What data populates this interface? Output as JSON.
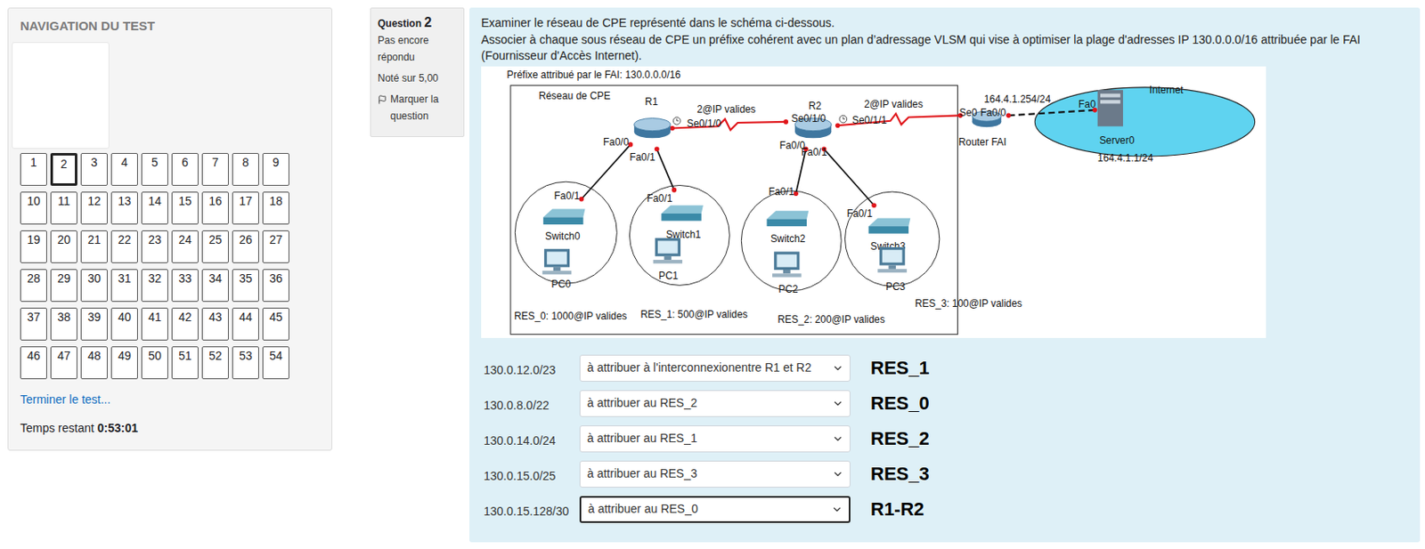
{
  "navigation": {
    "title": "NAVIGATION DU TEST",
    "items": [
      {
        "label": "1",
        "current": false
      },
      {
        "label": "2",
        "current": true
      },
      {
        "label": "3",
        "current": false
      },
      {
        "label": "4",
        "current": false
      },
      {
        "label": "5",
        "current": false
      },
      {
        "label": "6",
        "current": false
      },
      {
        "label": "7",
        "current": false
      },
      {
        "label": "8",
        "current": false
      },
      {
        "label": "9",
        "current": false
      },
      {
        "label": "10",
        "current": false
      },
      {
        "label": "11",
        "current": false
      },
      {
        "label": "12",
        "current": false
      },
      {
        "label": "13",
        "current": false
      },
      {
        "label": "14",
        "current": false
      },
      {
        "label": "15",
        "current": false
      },
      {
        "label": "16",
        "current": false
      },
      {
        "label": "17",
        "current": false
      },
      {
        "label": "18",
        "current": false
      },
      {
        "label": "19",
        "current": false
      },
      {
        "label": "20",
        "current": false
      },
      {
        "label": "21",
        "current": false
      },
      {
        "label": "22",
        "current": false
      },
      {
        "label": "23",
        "current": false
      },
      {
        "label": "24",
        "current": false
      },
      {
        "label": "25",
        "current": false
      },
      {
        "label": "26",
        "current": false
      },
      {
        "label": "27",
        "current": false
      },
      {
        "label": "28",
        "current": false
      },
      {
        "label": "29",
        "current": false
      },
      {
        "label": "30",
        "current": false
      },
      {
        "label": "31",
        "current": false
      },
      {
        "label": "32",
        "current": false
      },
      {
        "label": "33",
        "current": false
      },
      {
        "label": "34",
        "current": false
      },
      {
        "label": "35",
        "current": false
      },
      {
        "label": "36",
        "current": false
      },
      {
        "label": "37",
        "current": false
      },
      {
        "label": "38",
        "current": false
      },
      {
        "label": "39",
        "current": false
      },
      {
        "label": "40",
        "current": false
      },
      {
        "label": "41",
        "current": false
      },
      {
        "label": "42",
        "current": false
      },
      {
        "label": "43",
        "current": false
      },
      {
        "label": "44",
        "current": false
      },
      {
        "label": "45",
        "current": false
      },
      {
        "label": "46",
        "current": false
      },
      {
        "label": "47",
        "current": false
      },
      {
        "label": "48",
        "current": false
      },
      {
        "label": "49",
        "current": false
      },
      {
        "label": "50",
        "current": false
      },
      {
        "label": "51",
        "current": false
      },
      {
        "label": "52",
        "current": false
      },
      {
        "label": "53",
        "current": false
      },
      {
        "label": "54",
        "current": false
      }
    ],
    "finish_link": "Terminer le test...",
    "timer_label": "Temps restant",
    "timer_value": "0:53:01"
  },
  "question_info": {
    "prefix": "Question",
    "number": "2",
    "status": "Pas encore répondu",
    "grade": "Noté sur 5,00",
    "flag": "Marquer la question"
  },
  "question": {
    "lines": [
      "Examiner le réseau de CPE représenté dans le schéma ci-dessous.",
      "Associer à chaque sous réseau de CPE un préfixe cohérent avec un plan d’adressage VLSM qui vise à optimiser la plage d'adresses IP 130.0.0.0/16 attribuée par le FAI",
      "(Fournisseur d'Accès Internet)."
    ]
  },
  "diagram": {
    "isp_prefix": "Préfixe attribué par le FAI: 130.0.0.0/16",
    "cpe_label": "Réseau de CPE",
    "routers": [
      "R1",
      "R2",
      "Router FAI"
    ],
    "links": [
      "2@IP valides",
      "2@IP valides"
    ],
    "interfaces": [
      "Se0/1/0",
      "Se0/1/0",
      "Se0/1/1",
      "Se0",
      "Fa0/0",
      "Fa0",
      "Fa0/0",
      "Fa0/1",
      "Fa0/0",
      "Fa0/1",
      "Fa0/1",
      "Fa0/1",
      "Fa0/1",
      "Fa0/1"
    ],
    "isp_gateway": "164.4.1.254/24",
    "internet": {
      "label": "Internet",
      "server": "Server0",
      "address": "164.4.1.1/24"
    },
    "lans": [
      {
        "switch": "Switch0",
        "pc": "PC0",
        "label": "RES_0: 1000@IP valides"
      },
      {
        "switch": "Switch1",
        "pc": "PC1",
        "label": "RES_1: 500@IP valides"
      },
      {
        "switch": "Switch2",
        "pc": "PC2",
        "label": "RES_2: 200@IP valides"
      },
      {
        "switch": "Switch3",
        "pc": "PC3",
        "label": "RES_3: 100@IP valides"
      }
    ]
  },
  "answers": [
    {
      "prefix": "130.0.12.0/23",
      "selected": "à attribuer à l'interconnexionentre R1 et R2",
      "note": "RES_1",
      "focused": false
    },
    {
      "prefix": "130.0.8.0/22",
      "selected": "à attribuer au RES_2",
      "note": "RES_0",
      "focused": false
    },
    {
      "prefix": "130.0.14.0/24",
      "selected": "à attribuer au RES_1",
      "note": "RES_2",
      "focused": false
    },
    {
      "prefix": "130.0.15.0/25",
      "selected": "à attribuer au RES_3",
      "note": "RES_3",
      "focused": false
    },
    {
      "prefix": "130.0.15.128/30",
      "selected": "à attribuer au RES_0",
      "note": "R1-R2",
      "focused": true
    }
  ]
}
